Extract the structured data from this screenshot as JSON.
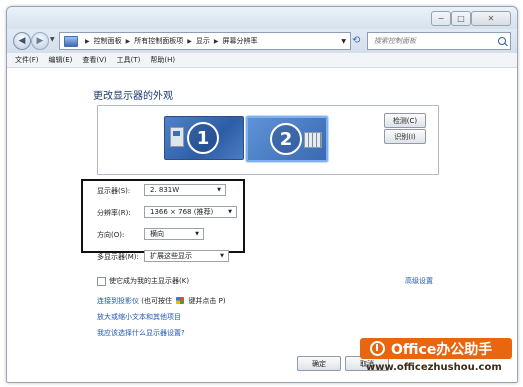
{
  "window": {
    "controls": {
      "minimize": "−",
      "maximize": "□",
      "close": "✕"
    }
  },
  "address": {
    "crumbs": [
      "控制面板",
      "所有控制面板项",
      "显示",
      "屏幕分辨率"
    ],
    "refresh_icon": "refresh-icon",
    "search_placeholder": "搜索控制面板"
  },
  "menu": [
    "文件(F)",
    "编辑(E)",
    "查看(V)",
    "工具(T)",
    "帮助(H)"
  ],
  "main": {
    "title": "更改显示器的外观",
    "monitors": [
      "1",
      "2"
    ],
    "detect_label": "检测(C)",
    "identify_label": "识别(I)"
  },
  "settings": {
    "display_label": "显示器(S):",
    "display_value": "2. 831W",
    "resolution_label": "分辨率(R):",
    "resolution_value": "1366 × 768 (推荐)",
    "orientation_label": "方向(O):",
    "orientation_value": "横向",
    "multi_label": "多显示器(M):",
    "multi_value": "扩展这些显示"
  },
  "options": {
    "main_display_checkbox": "使它成为我的主显示器(K)",
    "main_display_checked": false,
    "advanced_link": "高级设置"
  },
  "links": {
    "projector_link": "连接到投影仪",
    "projector_hint_pre": "(也可按住",
    "projector_hint_post": "键并点击 P)",
    "text_size_link": "放大或缩小文本和其他项目",
    "help_link": "我应该选择什么显示器设置?"
  },
  "buttons": {
    "ok": "确定",
    "cancel": "取消"
  },
  "watermark": {
    "brand": "Office办公助手",
    "url": "www.officezhushou.com"
  },
  "colors": {
    "link": "#1f58b6",
    "accent": "#e8660f",
    "selected_monitor": "#7fb1f0"
  }
}
